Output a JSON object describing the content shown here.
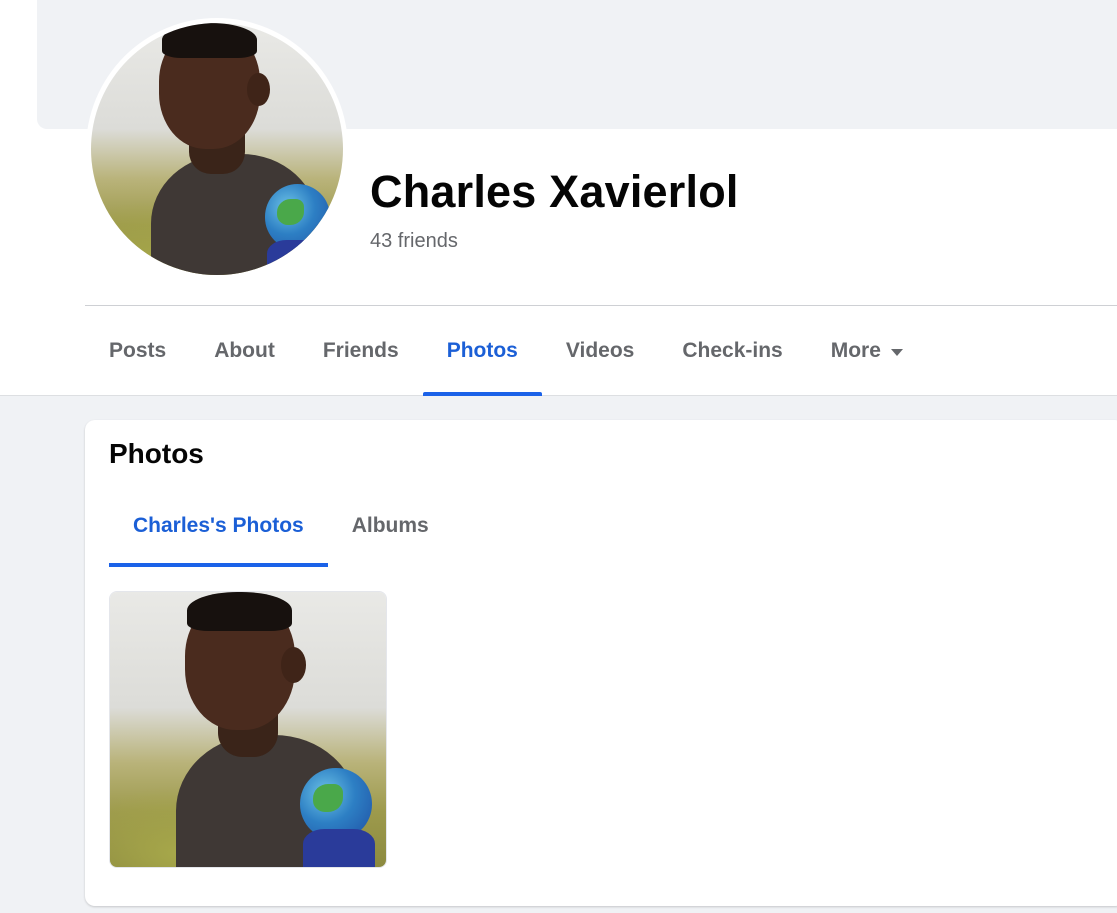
{
  "profile": {
    "name": "Charles Xavierlol",
    "friends_count": "43 friends"
  },
  "nav": {
    "tabs": [
      {
        "label": "Posts"
      },
      {
        "label": "About"
      },
      {
        "label": "Friends"
      },
      {
        "label": "Photos",
        "active": true
      },
      {
        "label": "Videos"
      },
      {
        "label": "Check-ins"
      },
      {
        "label": "More",
        "icon": "caret-down-icon"
      }
    ]
  },
  "photos_section": {
    "title": "Photos",
    "subtabs": [
      {
        "label": "Charles's Photos",
        "active": true
      },
      {
        "label": "Albums"
      }
    ]
  },
  "colors": {
    "accent": "#1b62e8",
    "background": "#f0f2f5",
    "text_primary": "#050505",
    "text_secondary": "#65676b"
  }
}
